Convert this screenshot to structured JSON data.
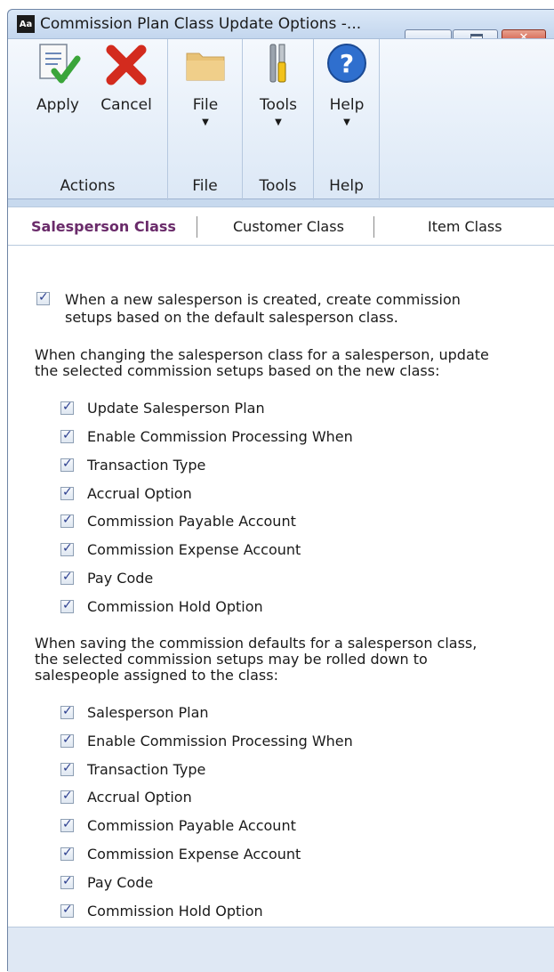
{
  "window": {
    "title": "Commission Plan Class Update Options  -...",
    "app_icon_text": "Aa",
    "minimize_glyph": "",
    "close_glyph": "✕"
  },
  "ribbon": {
    "groups": [
      {
        "label": "Actions",
        "buttons": [
          {
            "label": "Apply",
            "icon": "apply-document-check-icon"
          },
          {
            "label": "Cancel",
            "icon": "cancel-red-x-icon"
          }
        ]
      },
      {
        "label": "File",
        "buttons": [
          {
            "label": "File",
            "icon": "folder-icon"
          }
        ]
      },
      {
        "label": "Tools",
        "buttons": [
          {
            "label": "Tools",
            "icon": "tools-icon"
          }
        ]
      },
      {
        "label": "Help",
        "buttons": [
          {
            "label": "Help",
            "icon": "help-icon"
          }
        ]
      }
    ],
    "dropdown_arrow": "▼"
  },
  "tabs": [
    {
      "label": "Salesperson Class",
      "active": true
    },
    {
      "label": "Customer Class",
      "active": false
    },
    {
      "label": "Item Class",
      "active": false
    }
  ],
  "main": {
    "new_salesperson_line1": "When a new salesperson is created, create commission",
    "new_salesperson_line2": "setups based on the default salesperson class.",
    "change_intro_line1": "When changing the salesperson class for a salesperson, update",
    "change_intro_line2": "the selected commission setups based on the new class:",
    "change_options": [
      "Update Salesperson Plan",
      "Enable Commission Processing When",
      "Transaction Type",
      "Accrual Option",
      "Commission Payable Account",
      "Commission Expense Account",
      "Pay Code",
      "Commission Hold Option"
    ],
    "save_intro_line1": "When saving the commission defaults for a salesperson class,",
    "save_intro_line2": "the selected commission setups may be rolled down to",
    "save_intro_line3": "salespeople assigned to the class:",
    "save_options": [
      "Salesperson Plan",
      "Enable Commission Processing When",
      "Transaction Type",
      "Accrual Option",
      "Commission Payable Account",
      "Commission Expense Account",
      "Pay Code",
      "Commission Hold Option"
    ]
  },
  "colors": {
    "active_tab": "#6a2b6a",
    "ribbon_bg": "#dce8f6",
    "checkmark": "#2c3f8f"
  }
}
